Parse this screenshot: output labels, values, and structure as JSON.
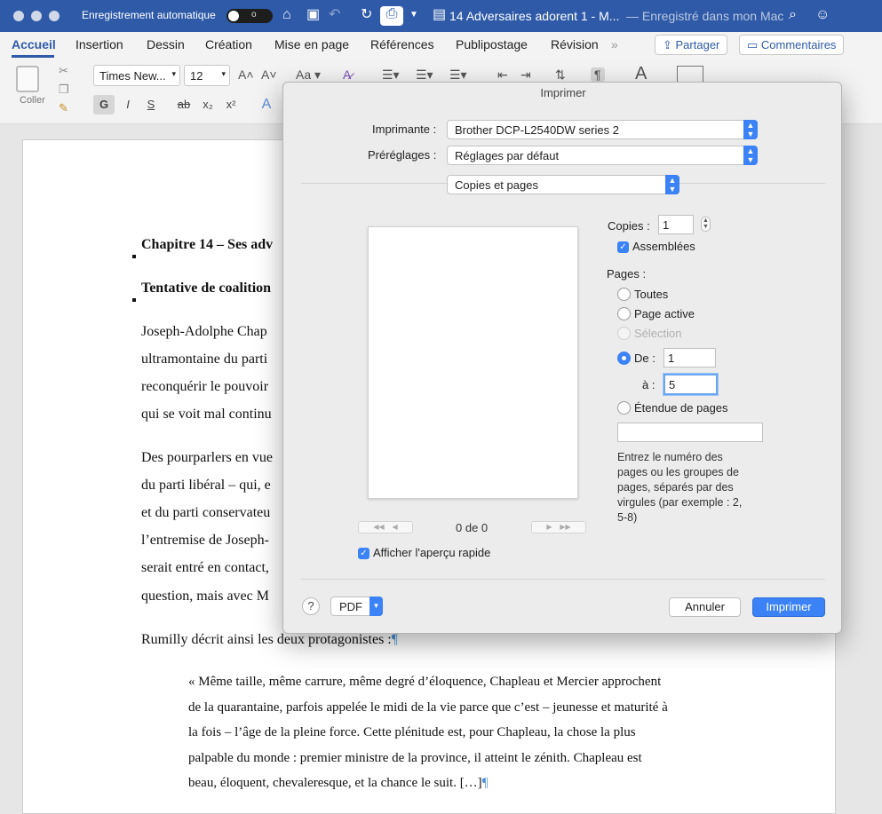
{
  "titlebar": {
    "autosave_label": "Enregistrement automatique",
    "toggle_state": "o",
    "doc_title": "14 Adversaires adorent 1 - M...",
    "save_status": "— Enregistré dans mon Mac"
  },
  "ribbon": {
    "tabs": [
      {
        "label": "Accueil",
        "active": true
      },
      {
        "label": "Insertion"
      },
      {
        "label": "Dessin"
      },
      {
        "label": "Création"
      },
      {
        "label": "Mise en page"
      },
      {
        "label": "Références"
      },
      {
        "label": "Publipostage"
      },
      {
        "label": "Révision"
      }
    ],
    "share_label": "Partager",
    "comments_label": "Commentaires",
    "paste_label": "Coller",
    "font_name": "Times New...",
    "font_size": "12",
    "bold_label": "G",
    "italic_label": "I",
    "underline_label": "S",
    "strike_label": "ab",
    "subscript_label": "x₂",
    "superscript_label": "x²"
  },
  "document": {
    "lines": [
      "Chapitre 14 – Ses adv",
      "Tentative de coalition",
      "Joseph-Adolphe Chap",
      "ultramontaine du parti",
      "reconquérir le pouvoir",
      "qui se voit mal continu",
      "Des pourparlers en vue",
      "du parti libéral – qui, e",
      "et du parti conservateu",
      "l’entremise de Joseph-",
      "serait entré en contact,",
      "question, mais avec M",
      "Rumilly décrit ainsi les deux protagonistes :"
    ],
    "quote_lines": [
      "« Même taille, même carrure, même degré d’éloquence, Chapleau et Mercier approchent",
      "de la quarantaine, parfois appelée le midi de la vie parce que c’est – jeunesse et maturité à",
      "la fois – l’âge de la pleine force. Cette plénitude est, pour Chapleau, la chose la plus",
      "palpable du monde : premier ministre de la province, il atteint le zénith. Chapleau est",
      "beau, éloquent, chevaleresque, et la chance le suit. […]"
    ],
    "pilcrow": "¶"
  },
  "print_dialog": {
    "title": "Imprimer",
    "printer_label": "Imprimante :",
    "printer_value": "Brother DCP-L2540DW series 2",
    "presets_label": "Préréglages :",
    "presets_value": "Réglages par défaut",
    "section_value": "Copies et pages",
    "page_counter": "0 de 0",
    "quick_preview_label": "Afficher l'aperçu rapide",
    "copies_label": "Copies :",
    "copies_value": "1",
    "collated_label": "Assemblées",
    "pages_label": "Pages :",
    "opt_all": "Toutes",
    "opt_current": "Page active",
    "opt_selection": "Sélection",
    "opt_from": "De :",
    "from_value": "1",
    "to_label": "à :",
    "to_value": "5",
    "opt_range": "Étendue de pages",
    "range_value": "",
    "help_text": "Entrez le numéro des\npages ou les groupes de\npages, séparés par des\nvirgules (par exemple : 2,\n5-8)",
    "help_button": "?",
    "pdf_label": "PDF",
    "cancel_label": "Annuler",
    "print_label": "Imprimer"
  }
}
